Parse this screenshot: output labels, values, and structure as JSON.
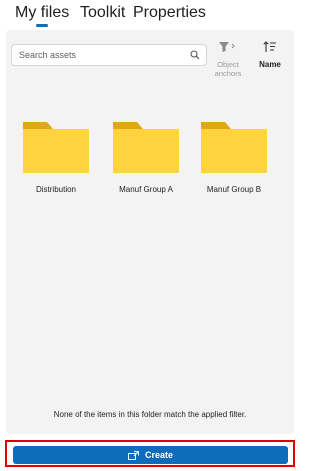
{
  "tabs": [
    {
      "label": "My files",
      "active": true
    },
    {
      "label": "Toolkit",
      "active": false
    },
    {
      "label": "Properties",
      "active": false
    }
  ],
  "toolbar": {
    "search_placeholder": "Search assets",
    "filter_label": "Object anchors",
    "filter_label_line1": "Object",
    "filter_label_line2": "anchors",
    "sort_label": "Name"
  },
  "folders": [
    {
      "name": "Distribution",
      "icon": "folder-icon"
    },
    {
      "name": "Manuf Group A",
      "icon": "folder-icon"
    },
    {
      "name": "Manuf Group B",
      "icon": "folder-icon"
    }
  ],
  "empty_message": "None of the items in this folder match the applied filter.",
  "create_button": {
    "label": "Create",
    "icon": "create-new-icon"
  },
  "colors": {
    "accent": "#0f6cbd",
    "panel_bg": "#f3f3f3",
    "folder_front": "#ffd23f",
    "folder_back": "#e0a717",
    "highlight_outline": "#e00000"
  }
}
